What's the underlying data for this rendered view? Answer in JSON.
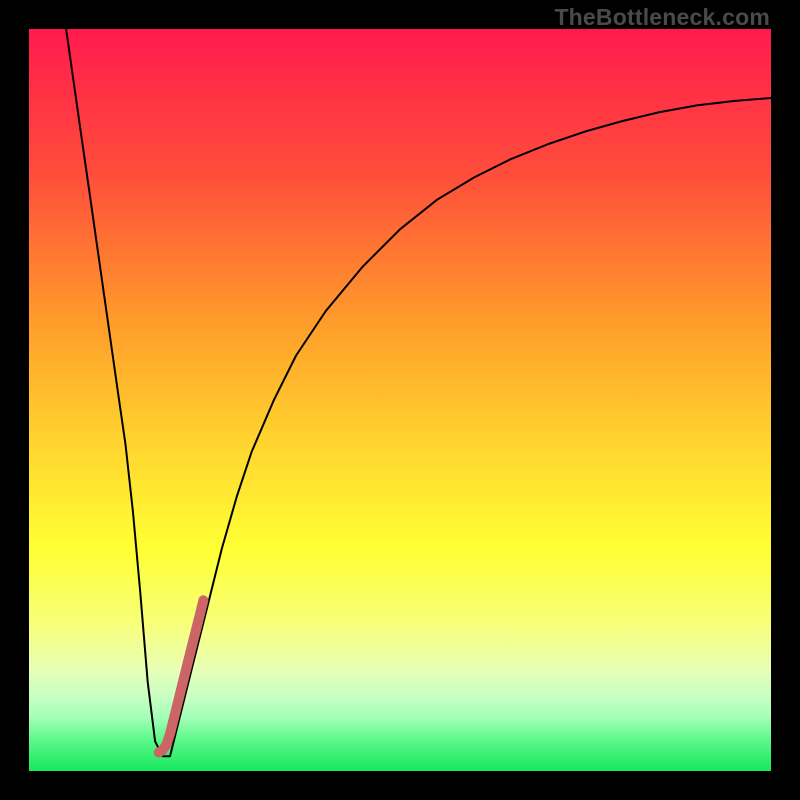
{
  "watermark": "TheBottleneck.com",
  "chart_data": {
    "type": "line",
    "title": "",
    "xlabel": "",
    "ylabel": "",
    "xlim": [
      0,
      100
    ],
    "ylim": [
      0,
      100
    ],
    "grid": false,
    "legend": false,
    "gradient_stops": [
      {
        "offset": 0,
        "color": "#ff1a4d"
      },
      {
        "offset": 20,
        "color": "#ff4f3a"
      },
      {
        "offset": 40,
        "color": "#ff9e2a"
      },
      {
        "offset": 55,
        "color": "#ffd22e"
      },
      {
        "offset": 70,
        "color": "#ffff33"
      },
      {
        "offset": 80,
        "color": "#f7ff78"
      },
      {
        "offset": 86,
        "color": "#e9ffb3"
      },
      {
        "offset": 90,
        "color": "#c8ffc3"
      },
      {
        "offset": 93,
        "color": "#9fffb5"
      },
      {
        "offset": 96,
        "color": "#58f787"
      },
      {
        "offset": 100,
        "color": "#17e85e"
      }
    ],
    "series": [
      {
        "name": "bottleneck-curve",
        "color": "#000000",
        "stroke_width": 2,
        "x": [
          5,
          6,
          7,
          8,
          9,
          10,
          11,
          12,
          13,
          14,
          15,
          16,
          17,
          18,
          19,
          20,
          22,
          24,
          26,
          28,
          30,
          33,
          36,
          40,
          45,
          50,
          55,
          60,
          65,
          70,
          75,
          80,
          85,
          90,
          95,
          100
        ],
        "y": [
          100,
          93,
          86,
          79,
          72,
          65,
          58,
          51,
          44,
          35,
          24,
          12,
          4,
          2,
          2,
          6,
          14,
          22,
          30,
          37,
          43,
          50,
          56,
          62,
          68,
          73,
          77,
          80,
          82.5,
          84.5,
          86.2,
          87.6,
          88.8,
          89.7,
          90.3,
          90.7
        ]
      },
      {
        "name": "highlight-segment",
        "color": "#cc6666",
        "stroke_width": 10,
        "linecap": "round",
        "x": [
          17.5,
          18.0,
          18.5,
          19.0,
          19.5,
          20.0,
          20.5,
          21.0,
          21.5,
          22.0,
          22.5,
          23.0,
          23.5
        ],
        "y": [
          2.5,
          2.8,
          3.5,
          5.0,
          7.0,
          9.0,
          11.0,
          13.0,
          15.0,
          17.0,
          19.0,
          21.0,
          23.0
        ]
      }
    ]
  }
}
